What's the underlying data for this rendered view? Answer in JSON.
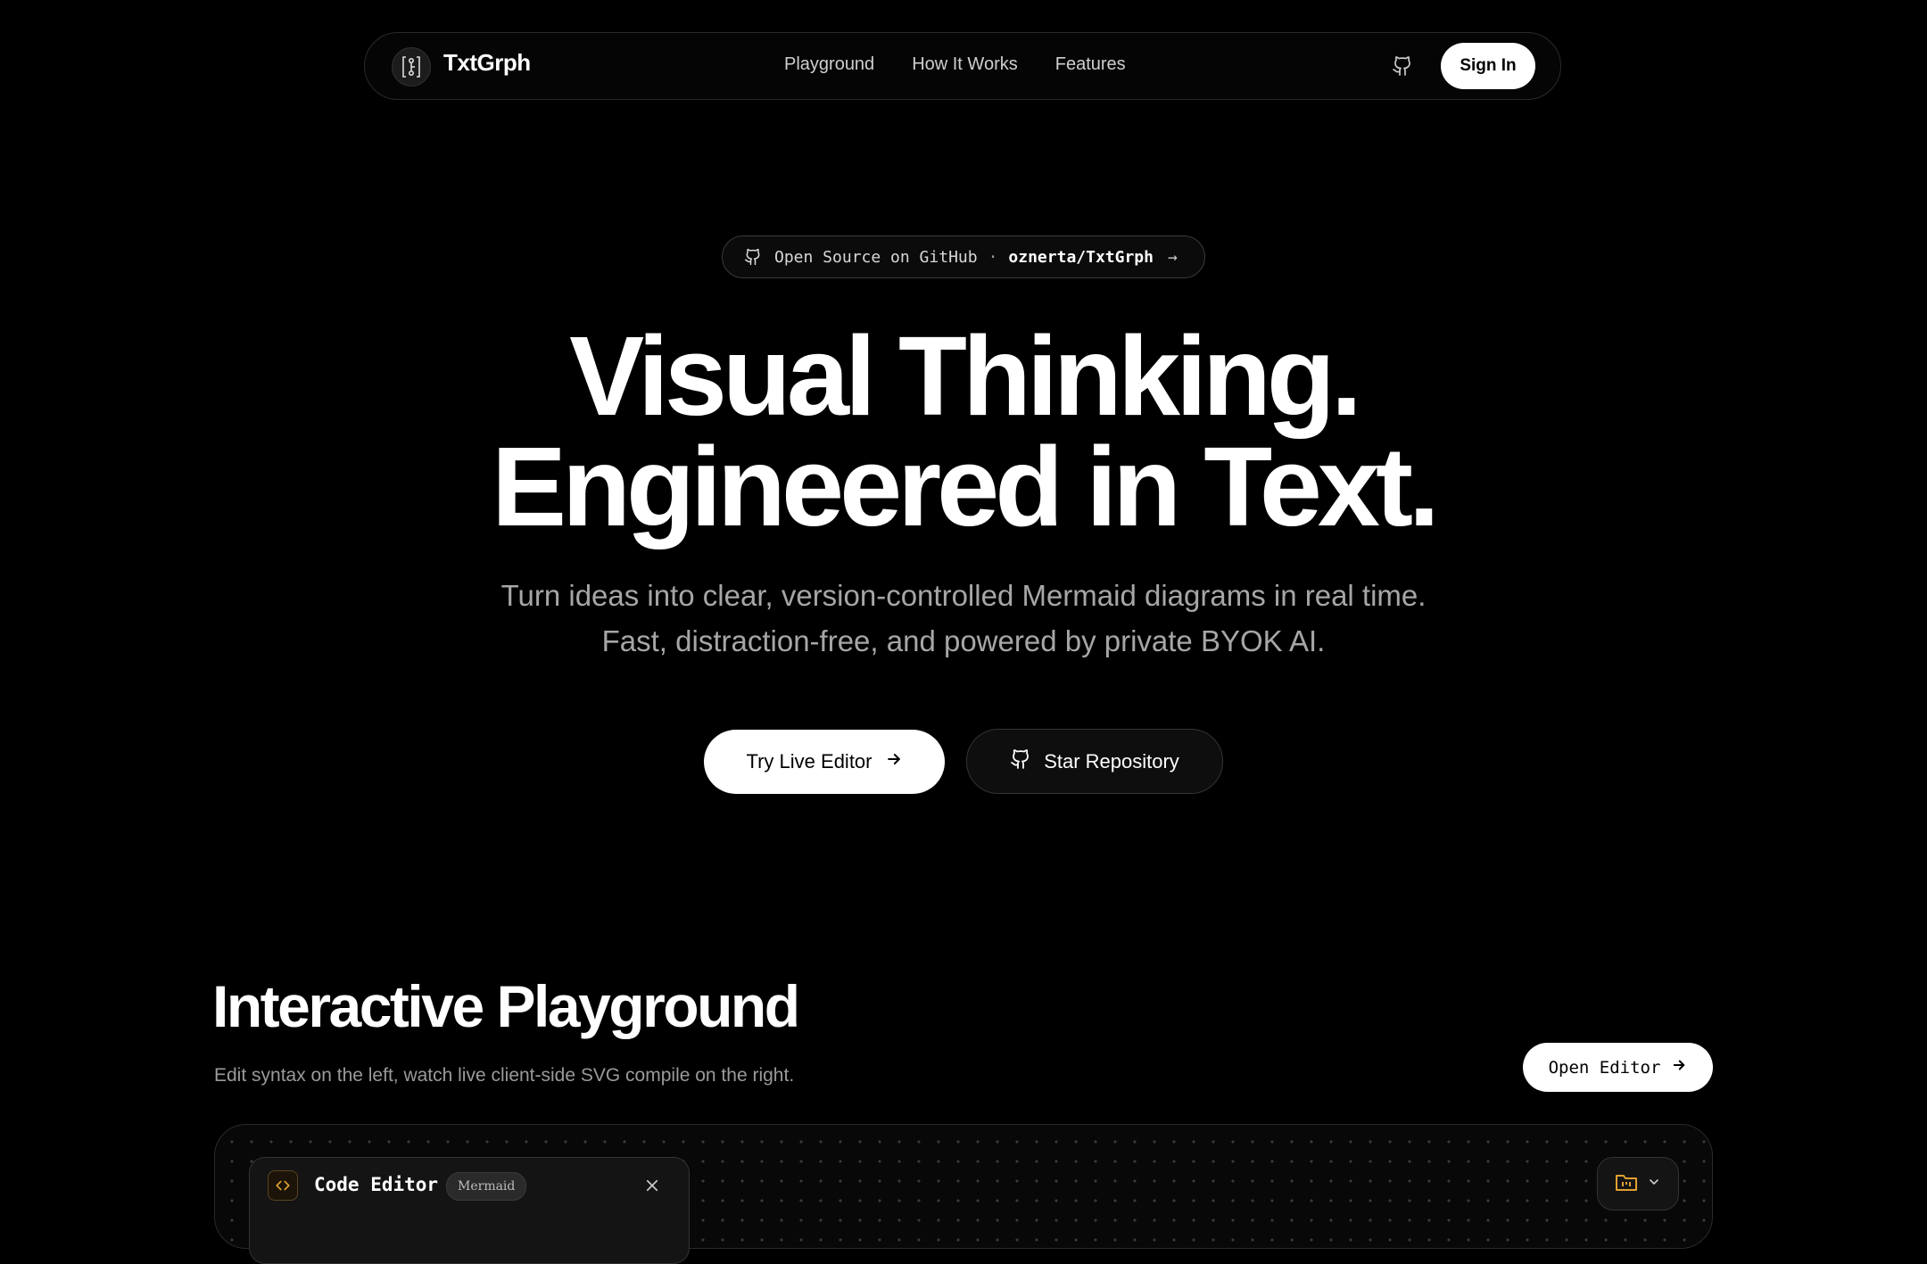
{
  "nav": {
    "brand": "TxtGrph",
    "links": [
      "Playground",
      "How It Works",
      "Features"
    ],
    "sign_in": "Sign In"
  },
  "badge": {
    "text": "Open Source on GitHub",
    "separator": "·",
    "repo": "oznerta/TxtGrph",
    "arrow": "→"
  },
  "hero": {
    "title_line1": "Visual Thinking.",
    "title_line2": "Engineered in Text.",
    "subtitle": "Turn ideas into clear, version-controlled Mermaid diagrams in real time. Fast, distraction-free, and powered by private BYOK AI.",
    "primary_cta": "Try Live Editor",
    "secondary_cta": "Star Repository"
  },
  "playground": {
    "title": "Interactive Playground",
    "subtitle": "Edit syntax on the left, watch live client-side SVG compile on the right.",
    "open_editor": "Open Editor",
    "editor": {
      "title": "Code Editor",
      "tag": "Mermaid"
    }
  },
  "colors": {
    "background": "#000000",
    "accent": "#e0a030",
    "text": "#ffffff",
    "muted": "#a6a6a6"
  },
  "icons": [
    "logo-icon",
    "github-icon",
    "arrow-right-icon",
    "code-icon",
    "close-icon",
    "folder-icon",
    "chevron-down-icon"
  ]
}
